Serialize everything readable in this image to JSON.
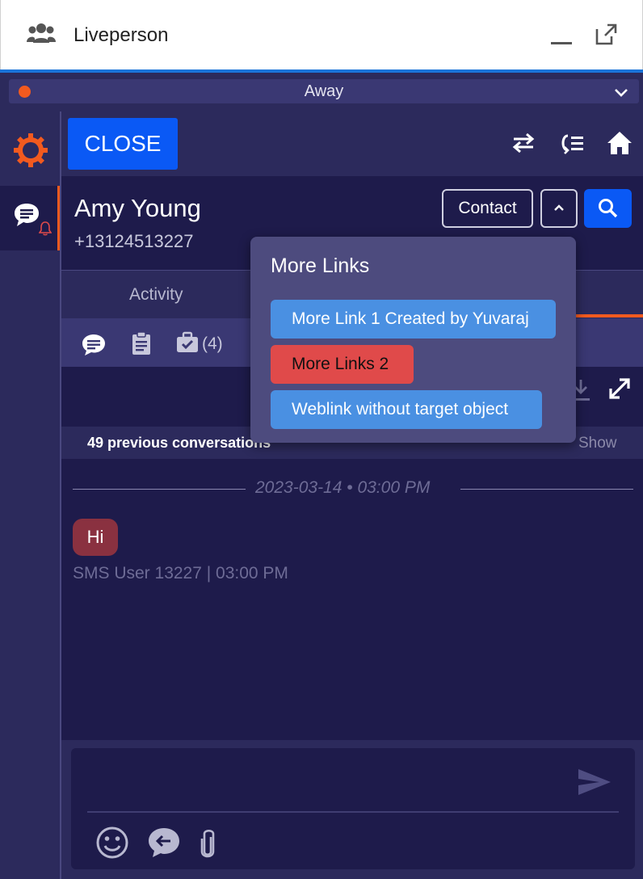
{
  "window": {
    "title": "Liveperson"
  },
  "status": {
    "label": "Away",
    "dot_color": "#f25a1f"
  },
  "toolbar": {
    "close_label": "CLOSE"
  },
  "contact": {
    "name": "Amy Young",
    "phone": "+13124513227",
    "contact_button": "Contact"
  },
  "tabs": {
    "activity": "Activity"
  },
  "icons_row": {
    "case_count": "(4)"
  },
  "history": {
    "previous_label": "49 previous conversations",
    "show_label": "Show"
  },
  "chat": {
    "date": "2023-03-14 • 03:00 PM",
    "message": "Hi",
    "sender": "SMS User 13227 | 03:00 PM"
  },
  "more_links": {
    "title": "More Links",
    "links": [
      {
        "label": "More Link 1 Created by Yuvaraj",
        "color": "#4a90e2"
      },
      {
        "label": "More Links 2",
        "color": "#e04a4a"
      },
      {
        "label": "Weblink without target object",
        "color": "#4a90e2"
      }
    ]
  },
  "colors": {
    "accent": "#0a59f5",
    "brand_orange": "#f25a1f",
    "panel": "#1e1b4b"
  }
}
